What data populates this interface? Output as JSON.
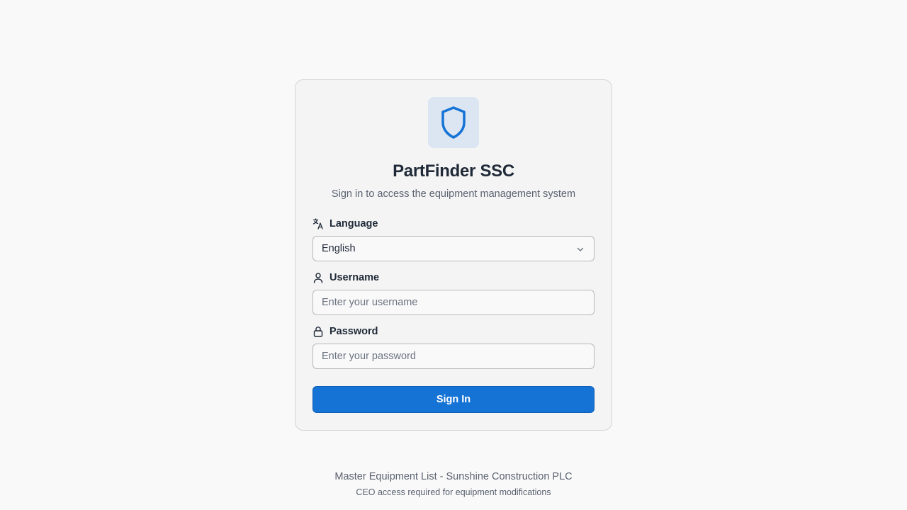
{
  "app": {
    "title": "PartFinder SSC",
    "subtitle": "Sign in to access the equipment management system",
    "logo_icon": "shield-icon",
    "accent_color": "#1573d6"
  },
  "form": {
    "language": {
      "label": "Language",
      "icon": "translate-icon",
      "selected": "English"
    },
    "username": {
      "label": "Username",
      "icon": "user-icon",
      "value": "",
      "placeholder": "Enter your username"
    },
    "password": {
      "label": "Password",
      "icon": "lock-icon",
      "value": "",
      "placeholder": "Enter your password"
    },
    "submit_label": "Sign In"
  },
  "footer": {
    "line1": "Master Equipment List - Sunshine Construction PLC",
    "line2": "CEO access required for equipment modifications"
  }
}
